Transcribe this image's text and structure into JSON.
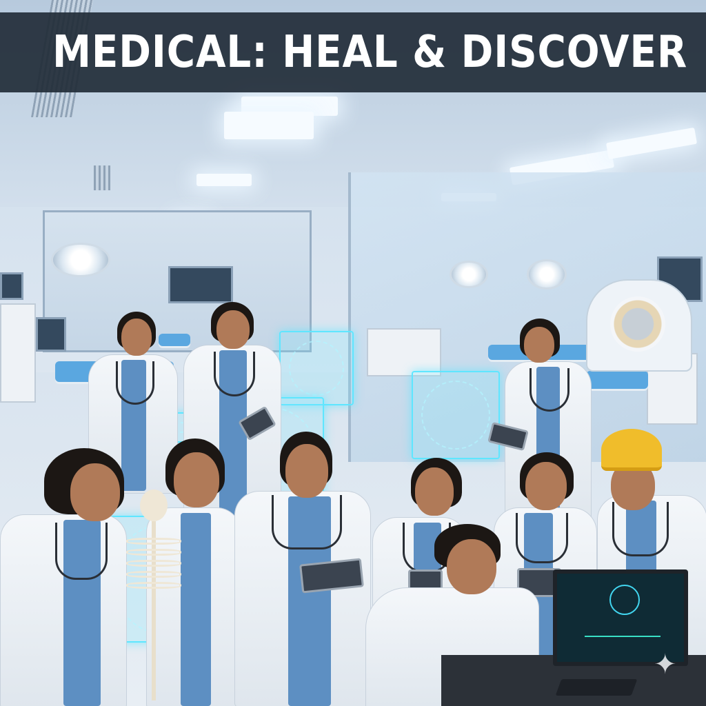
{
  "banner": {
    "title": "MEDICAL: HEAL & DISCOVER"
  },
  "scene": {
    "setting": "hospital-ward-with-operating-theatre",
    "accent_colors": {
      "banner_background": "#222c38",
      "banner_text": "#ffffff",
      "hologram": "#5fe6ff",
      "scrubs": "#5d8fc2",
      "helmet": "#f0bd2b"
    },
    "icons": [
      "sparkle-icon"
    ]
  }
}
